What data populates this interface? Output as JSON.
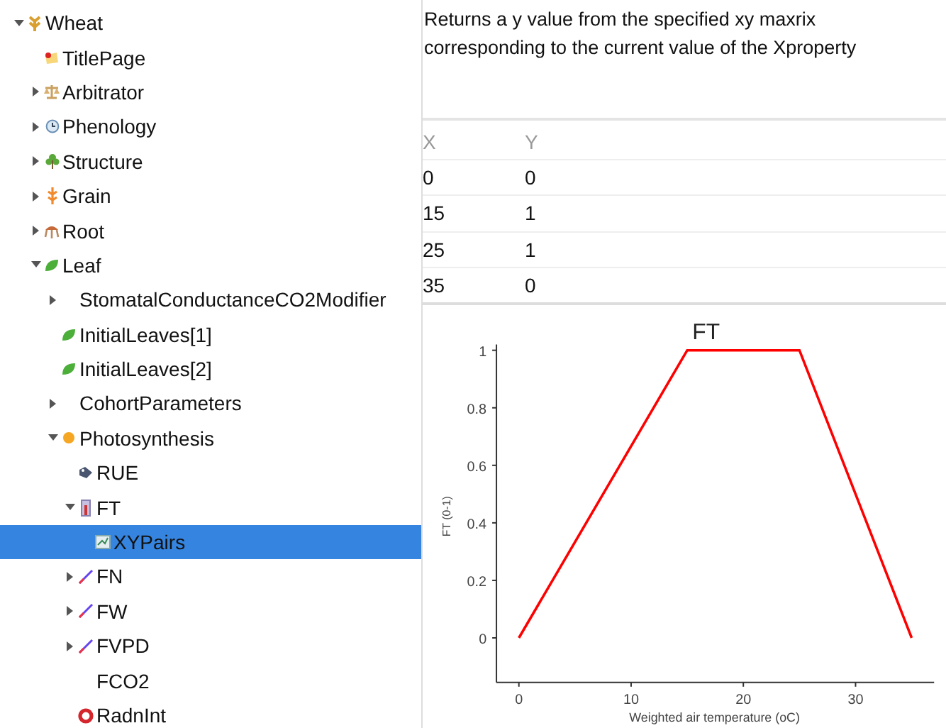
{
  "tree": [
    {
      "label": "Wheat",
      "kind": "wheat",
      "expanded": true,
      "selected": false,
      "children": [
        {
          "label": "TitlePage",
          "kind": "page",
          "selected": false
        },
        {
          "label": "Arbitrator",
          "kind": "scale",
          "expanded": false,
          "selected": false
        },
        {
          "label": "Phenology",
          "kind": "clock",
          "expanded": false,
          "selected": false
        },
        {
          "label": "Structure",
          "kind": "plant",
          "expanded": false,
          "selected": false
        },
        {
          "label": "Grain",
          "kind": "grain",
          "expanded": false,
          "selected": false
        },
        {
          "label": "Root",
          "kind": "root",
          "expanded": false,
          "selected": false
        },
        {
          "label": "Leaf",
          "kind": "leaf",
          "expanded": true,
          "selected": false,
          "children": [
            {
              "label": "StomatalConductanceCO2Modifier",
              "kind": "none",
              "expanded": false,
              "selected": false
            },
            {
              "label": "InitialLeaves[1]",
              "kind": "leaf",
              "selected": false
            },
            {
              "label": "InitialLeaves[2]",
              "kind": "leaf",
              "selected": false
            },
            {
              "label": "CohortParameters",
              "kind": "none",
              "expanded": false,
              "selected": false
            },
            {
              "label": "Photosynthesis",
              "kind": "dot",
              "expanded": true,
              "selected": false,
              "children": [
                {
                  "label": "RUE",
                  "kind": "rue",
                  "selected": false
                },
                {
                  "label": "FT",
                  "kind": "thermometer",
                  "expanded": true,
                  "selected": false,
                  "children": [
                    {
                      "label": "XYPairs",
                      "kind": "graph",
                      "selected": true
                    }
                  ]
                },
                {
                  "label": "FN",
                  "kind": "function",
                  "expanded": false,
                  "selected": false
                },
                {
                  "label": "FW",
                  "kind": "function",
                  "expanded": false,
                  "selected": false
                },
                {
                  "label": "FVPD",
                  "kind": "function",
                  "expanded": false,
                  "selected": false
                },
                {
                  "label": "FCO2",
                  "kind": "none",
                  "selected": false
                },
                {
                  "label": "RadnInt",
                  "kind": "ring",
                  "selected": false
                }
              ]
            }
          ]
        }
      ]
    }
  ],
  "description": "Returns a y value from the specified xy maxrix corresponding to the current value of the Xproperty",
  "table": {
    "columns": [
      "X",
      "Y"
    ],
    "rows": [
      [
        "0",
        "0"
      ],
      [
        "15",
        "1"
      ],
      [
        "25",
        "1"
      ],
      [
        "35",
        "0"
      ]
    ]
  },
  "chart_data": {
    "type": "line",
    "title": "FT",
    "xlabel": "Weighted air temperature (oC)",
    "ylabel": "FT (0-1)",
    "x": [
      0,
      15,
      25,
      35
    ],
    "series": [
      {
        "color": "#ff0000",
        "values": [
          0,
          1,
          1,
          0
        ]
      }
    ],
    "xlim": [
      -2,
      37
    ],
    "ylim": [
      -0.155,
      1.02
    ],
    "xticks": [
      0,
      10,
      20,
      30
    ],
    "yticks": [
      0,
      0.2,
      0.4,
      0.6,
      0.8,
      1
    ]
  }
}
